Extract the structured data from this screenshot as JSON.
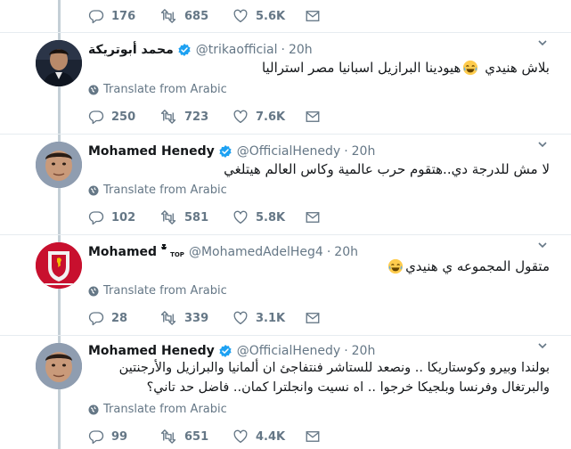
{
  "colors": {
    "text_primary": "#14171a",
    "text_secondary": "#657786",
    "link_blue": "#1da1f2",
    "thread_line": "#c4cfd6",
    "divider": "#e6ecf0"
  },
  "top_stats": {
    "replies": "176",
    "retweets": "685",
    "likes": "5.6K"
  },
  "tweets": [
    {
      "name": "محمد أبوتريكة",
      "verified": true,
      "handle": "@trikaofficial",
      "time": "20h",
      "text_before_emoji": "بلاش هنيدي ",
      "emoji": "face-with-tears-of-joy",
      "text_after_emoji": "هيودينا البرازيل اسبانيا مصر استراليا",
      "translate_label": "Translate from Arabic",
      "replies": "250",
      "retweets": "723",
      "likes": "7.6K"
    },
    {
      "name": "Mohamed Henedy",
      "verified": true,
      "handle": "@OfficialHenedy",
      "time": "20h",
      "text": "لا مش للدرجة دي..هتقوم حرب عالمية وكاس العالم هيتلغي",
      "translate_label": "Translate from Arabic",
      "replies": "102",
      "retweets": "581",
      "likes": "5.8K"
    },
    {
      "name": "Mohamed",
      "name_badge": "TOP",
      "verified": false,
      "handle": "@MohamedAdelHeg4",
      "time": "20h",
      "text": "متقول المجموعه  ي هنيدي",
      "emoji": "face-with-tears-of-joy",
      "translate_label": "Translate from Arabic",
      "replies": "28",
      "retweets": "339",
      "likes": "3.1K"
    },
    {
      "name": "Mohamed Henedy",
      "verified": true,
      "handle": "@OfficialHenedy",
      "time": "20h",
      "text_line1": "بولندا وبيرو وكوستاريكا .. ونصعد للستاشر فنتفاجئ ان ألمانيا والبرازيل والأرجنتين",
      "text_line2": "والبرتغال وفرنسا وبلجيكا خرجوا ..  اه نسيت وانجلترا كمان.. فاضل حد تاني؟",
      "translate_label": "Translate from Arabic",
      "replies": "99",
      "retweets": "651",
      "likes": "4.4K"
    }
  ]
}
